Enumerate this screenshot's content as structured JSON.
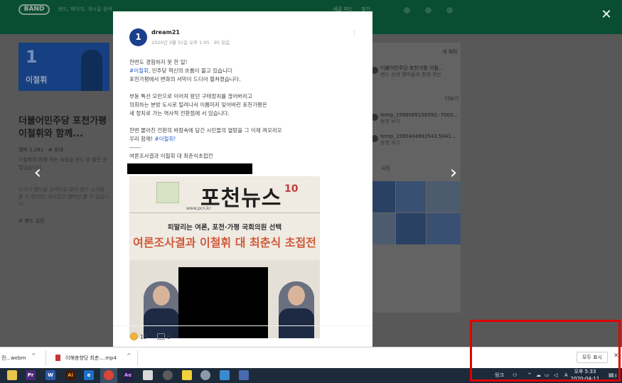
{
  "app": {
    "logo": "BAND",
    "search_placeholder": "밴드, 페이지, 게시글 검색",
    "nav_items": [
      "새글 피드",
      "찾기"
    ]
  },
  "band": {
    "card_number": "1",
    "card_name": "이철휘",
    "title": "더불어민주당 포천가평 이철휘와 함께...",
    "members": "멤버 1,261 · ⊕ 초대",
    "description": "이철휘와 함께 하는 사람을 반드 방 좋은 문 열었습니다.",
    "description2": "누구나 밴드를 검색으로 찾아 밴드 소개를 볼 수 있지만, 게시글은 멤버만 볼 수 있습니다.",
    "settings": "⚙ 밴드 설정"
  },
  "right_panel": {
    "label_top": "새 채팅",
    "chat_item": "더불어민주당 포천가평 이철...",
    "chat_sub": "밴드 선세 멤버들과 함께 하는",
    "label_files": "더보기",
    "file_1": "temp_1586089156592.-7000...",
    "file_1_sub": "동영 보기",
    "file_2": "temp_1585404893543.5041...",
    "file_2_sub": "동영 보기",
    "label_photos": "사진"
  },
  "post": {
    "avatar_text": "1",
    "author": "dream21",
    "meta": "2020년 3월 31일 오후 1:05 · 95 읽음",
    "lines": [
      "한번도 경험하지 못 한 일!",
      "#이철휘, 민주당 혁신의 흐름이 불고 있습니다",
      "포천가평에서 변화의 서막이 드디어 펼쳐졌습니다.",
      "",
      "부동 특선 오만으로 이어져 왔던 구태정치를 끊어버리고",
      "의회하는 분방 도시로 밀려나서 이름마저 잊어버린 포천가평은",
      "새 정치로 가는 역사적 전환점에 서 있습니다.",
      "",
      "한번 물아친 전환의 바람속에 담긴 시민들의 열망을 그 이제 껴오리오",
      "우리 함께! #이철휘!",
      "------",
      "여론조사결과 이철휘 대 최춘식초접전"
    ],
    "tag_1": "#이철휘",
    "tag_2": "#이철휘!",
    "like_count": "13",
    "comment_count": "6"
  },
  "newspaper": {
    "title": "포천뉴스",
    "anniversary": "10",
    "url": "www.pcn.kr",
    "subtitle": "피말리는 여론, 포천·가평 국회의원 선택",
    "headline": "여론조사결과 이철휘 대 최춘식 초접전"
  },
  "download_bar": {
    "item_1": "전...webm",
    "item_2": "이해충향당 최춘....mp4",
    "show_all": "모두 표시",
    "close": "✕"
  },
  "taskbar": {
    "tray_text": "링크",
    "lang": "A",
    "time": "오후 5:33",
    "date": "2020-04-11",
    "notification_count": "3"
  },
  "colors": {
    "band_green": "#0d6b47",
    "highlight_red": "#e00000",
    "tag_blue": "#2a62c9"
  }
}
